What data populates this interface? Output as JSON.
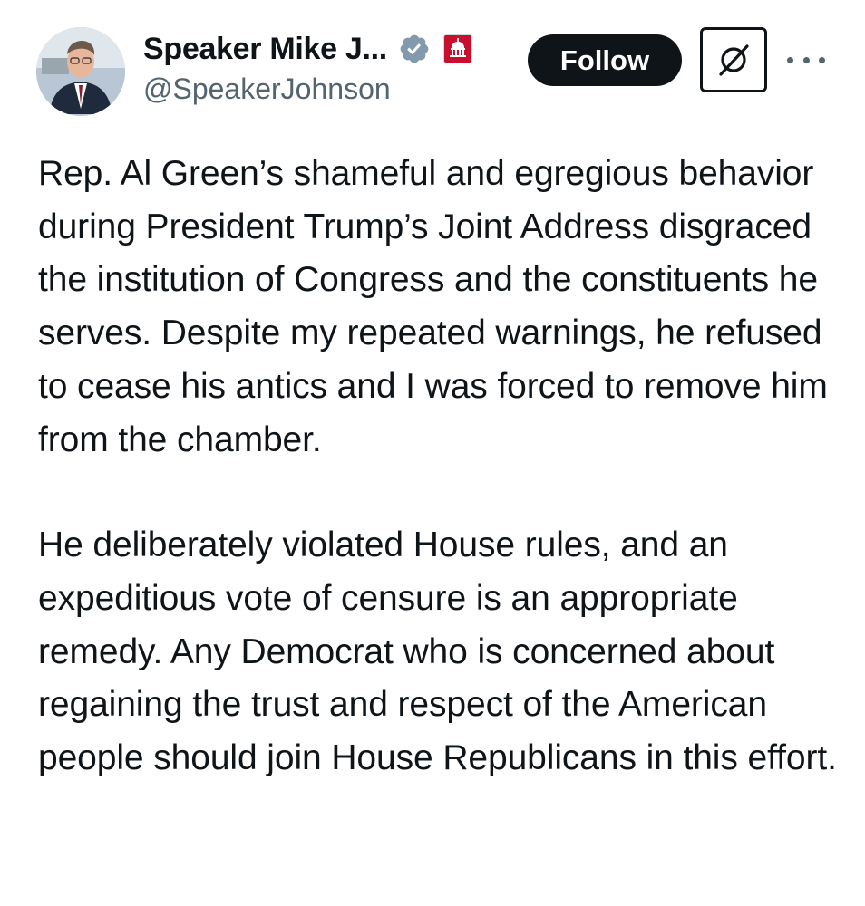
{
  "author": {
    "display_name": "Speaker Mike J...",
    "handle": "@SpeakerJohnson",
    "verified_badge_icon": "verified-badge-icon",
    "affiliation_icon": "capitol-affiliation-icon",
    "badge_color": "#829aab",
    "affiliation_color": "#c8102e"
  },
  "actions": {
    "follow_label": "Follow",
    "grok_icon": "grok-icon",
    "more_icon": "more-options-icon"
  },
  "tweet": {
    "paragraphs": [
      "Rep. Al Green’s shameful and egregious behavior during President Trump’s Joint Address disgraced the institution of Congress and the constituents he serves. Despite my repeated warnings, he refused to cease his antics and I was forced to remove him from the chamber.",
      "He deliberately violated House rules, and an expeditious vote of censure is an appropriate remedy. Any Democrat who is concerned about regaining the trust and respect of the American people should join House Republicans in this effort."
    ]
  }
}
